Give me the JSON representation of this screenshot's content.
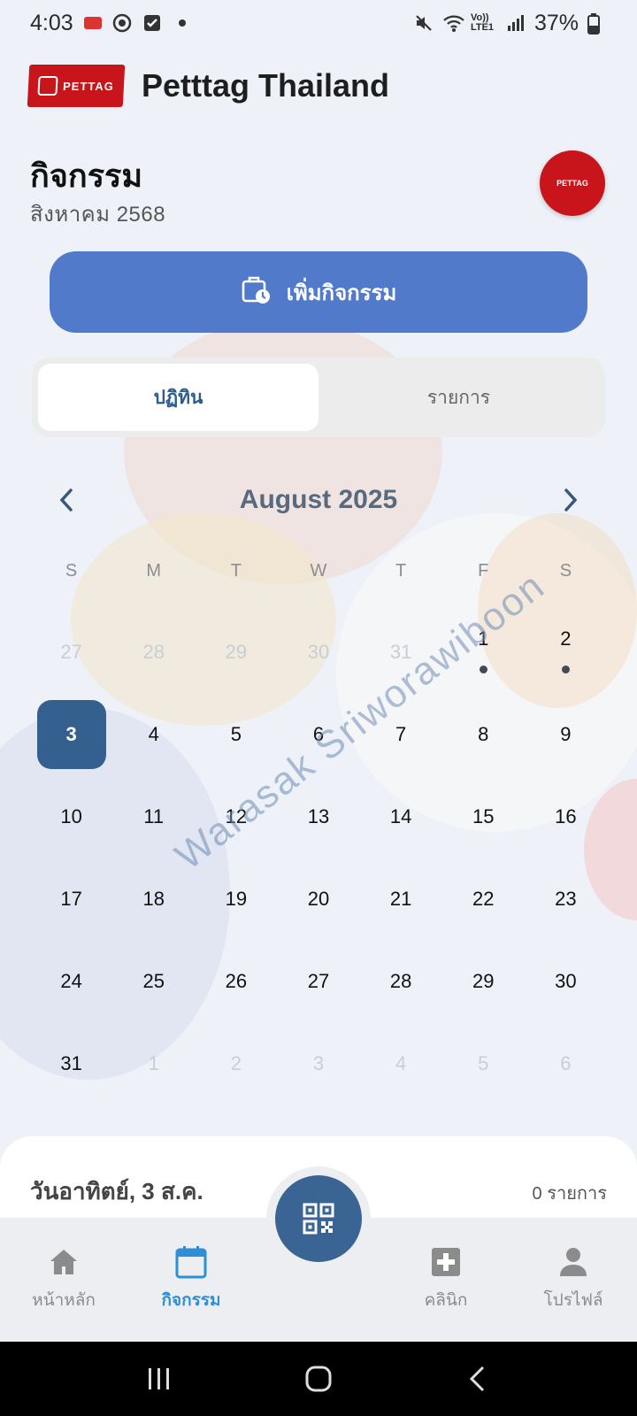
{
  "status_bar": {
    "time": "4:03",
    "network": "Vo)) LTE1",
    "battery": "37%"
  },
  "app": {
    "title": "Petttag Thailand",
    "logo_text": "PETTAG"
  },
  "page": {
    "title": "กิจกรรม",
    "subtitle": "สิงหาคม 2568",
    "avatar_text": "PETTAG"
  },
  "add_button": {
    "label": "เพิ่มกิจกรรม",
    "icon": "calendar-add-icon"
  },
  "segment": {
    "tabs": [
      {
        "label": "ปฏิทิน",
        "active": true
      },
      {
        "label": "รายการ",
        "active": false
      }
    ]
  },
  "calendar": {
    "month_label": "August 2025",
    "weekdays": [
      "S",
      "M",
      "T",
      "W",
      "T",
      "F",
      "S"
    ],
    "days": [
      {
        "label": "27",
        "muted": true
      },
      {
        "label": "28",
        "muted": true
      },
      {
        "label": "29",
        "muted": true
      },
      {
        "label": "30",
        "muted": true
      },
      {
        "label": "31",
        "muted": true
      },
      {
        "label": "1",
        "dot": true
      },
      {
        "label": "2",
        "dot": true
      },
      {
        "label": "3",
        "selected": true
      },
      {
        "label": "4"
      },
      {
        "label": "5"
      },
      {
        "label": "6"
      },
      {
        "label": "7"
      },
      {
        "label": "8"
      },
      {
        "label": "9"
      },
      {
        "label": "10"
      },
      {
        "label": "11"
      },
      {
        "label": "12"
      },
      {
        "label": "13"
      },
      {
        "label": "14"
      },
      {
        "label": "15"
      },
      {
        "label": "16"
      },
      {
        "label": "17"
      },
      {
        "label": "18"
      },
      {
        "label": "19"
      },
      {
        "label": "20"
      },
      {
        "label": "21"
      },
      {
        "label": "22"
      },
      {
        "label": "23"
      },
      {
        "label": "24"
      },
      {
        "label": "25"
      },
      {
        "label": "26"
      },
      {
        "label": "27"
      },
      {
        "label": "28"
      },
      {
        "label": "29"
      },
      {
        "label": "30"
      },
      {
        "label": "31"
      },
      {
        "label": "1",
        "muted": true
      },
      {
        "label": "2",
        "muted": true
      },
      {
        "label": "3",
        "muted": true
      },
      {
        "label": "4",
        "muted": true
      },
      {
        "label": "5",
        "muted": true
      },
      {
        "label": "6",
        "muted": true
      }
    ]
  },
  "watermark": "Warasak Sriworawiboon",
  "sheet": {
    "date_label": "วันอาทิตย์, 3 ส.ค.",
    "count_label": "0 รายการ"
  },
  "bottom_nav": {
    "items": [
      {
        "label": "หน้าหลัก",
        "icon": "home-icon",
        "active": false
      },
      {
        "label": "กิจกรรม",
        "icon": "calendar-icon",
        "active": true
      },
      {
        "label": "คลินิก",
        "icon": "medical-cross-icon",
        "active": false
      },
      {
        "label": "โปรไฟล์",
        "icon": "person-icon",
        "active": false
      }
    ],
    "fab_icon": "qr-code-icon"
  },
  "colors": {
    "primary": "#527acb",
    "selected_day": "#34608f",
    "active_nav": "#2e8fd6",
    "brand_red": "#c8141b"
  }
}
